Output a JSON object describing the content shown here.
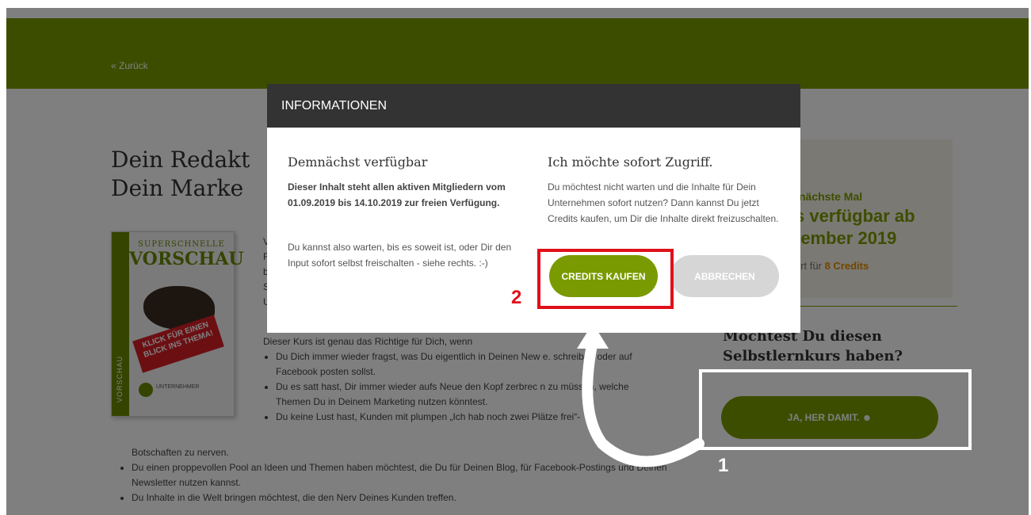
{
  "header": {
    "back_link": "« Zurück"
  },
  "hero": {
    "title_line1": "Dein Redakt",
    "title_line2": "Dein Marke"
  },
  "book": {
    "top_small": "SUPERSCHNELLE",
    "top_big": "VORSCHAU",
    "banner": "KLICK FÜR EINEN BLICK INS THEMA!",
    "spine": "VORSCHAU",
    "logo": "UNTERNEHMER"
  },
  "content": {
    "partial_letters": [
      "V",
      "F",
      "b",
      "S",
      "U"
    ],
    "intro": "Dieser Kurs ist genau das Richtige für Dich, wenn",
    "bullets_indented": [
      "Du Dich immer wieder fragst, was Du eigentlich in Deinen New     e. schreiben oder auf Facebook posten sollst.",
      "Du es satt hast, Dir immer wieder aufs Neue den Kopf zerbrec    n zu müssen, welche Themen Du in Deinem Marketing nutzen könntest.",
      "Du keine Lust hast, Kunden mit plumpen „Ich hab noch zwei Plätze frei“-"
    ],
    "continuation": "Botschaften zu nerven.",
    "bullets_full": [
      "Du einen proppevollen Pool an Ideen und Themen haben möchtest, die Du für Deinen Blog, für Facebook-Postings und Deinen Newsletter nutzen kannst.",
      "Du Inhalte in die Welt bringen möchtest, die den Nerv Deines Kunden treffen."
    ]
  },
  "sidebar": {
    "promo_line1": "nächste Mal",
    "promo_line2": "s verfügbar ab",
    "promo_line3": "tember 2019",
    "promo_line4_prefix": "ort für",
    "promo_line4_credits": "8 Credits",
    "heading": "Möchtest Du diesen Selbstlernkurs haben?",
    "cta_label": "JA, HER DAMIT. ☻"
  },
  "modal": {
    "title": "INFORMATIONEN",
    "left": {
      "heading": "Demnächst verfügbar",
      "bold": "Dieser Inhalt steht allen aktiven Mitgliedern vom 01.09.2019 bis 14.10.2019 zur freien Verfügung.",
      "text": "Du kannst also warten, bis es soweit ist, oder Dir den Input sofort selbst freischalten - siehe rechts. :-)"
    },
    "right": {
      "heading": "Ich möchte sofort Zugriff.",
      "text": "Du möchtest nicht warten und die Inhalte für Dein Unternehmen sofort nutzen? Dann kannst Du jetzt Credits kaufen, um Dir die Inhalte direkt freizuschalten."
    },
    "buy_label": "CREDITS KAUFEN",
    "cancel_label": "ABBRECHEN"
  },
  "annotations": {
    "step1": "1",
    "step2": "2"
  },
  "colors": {
    "brand_green": "#7a9a01",
    "highlight_red": "#e0101b",
    "modal_header": "#333333"
  }
}
